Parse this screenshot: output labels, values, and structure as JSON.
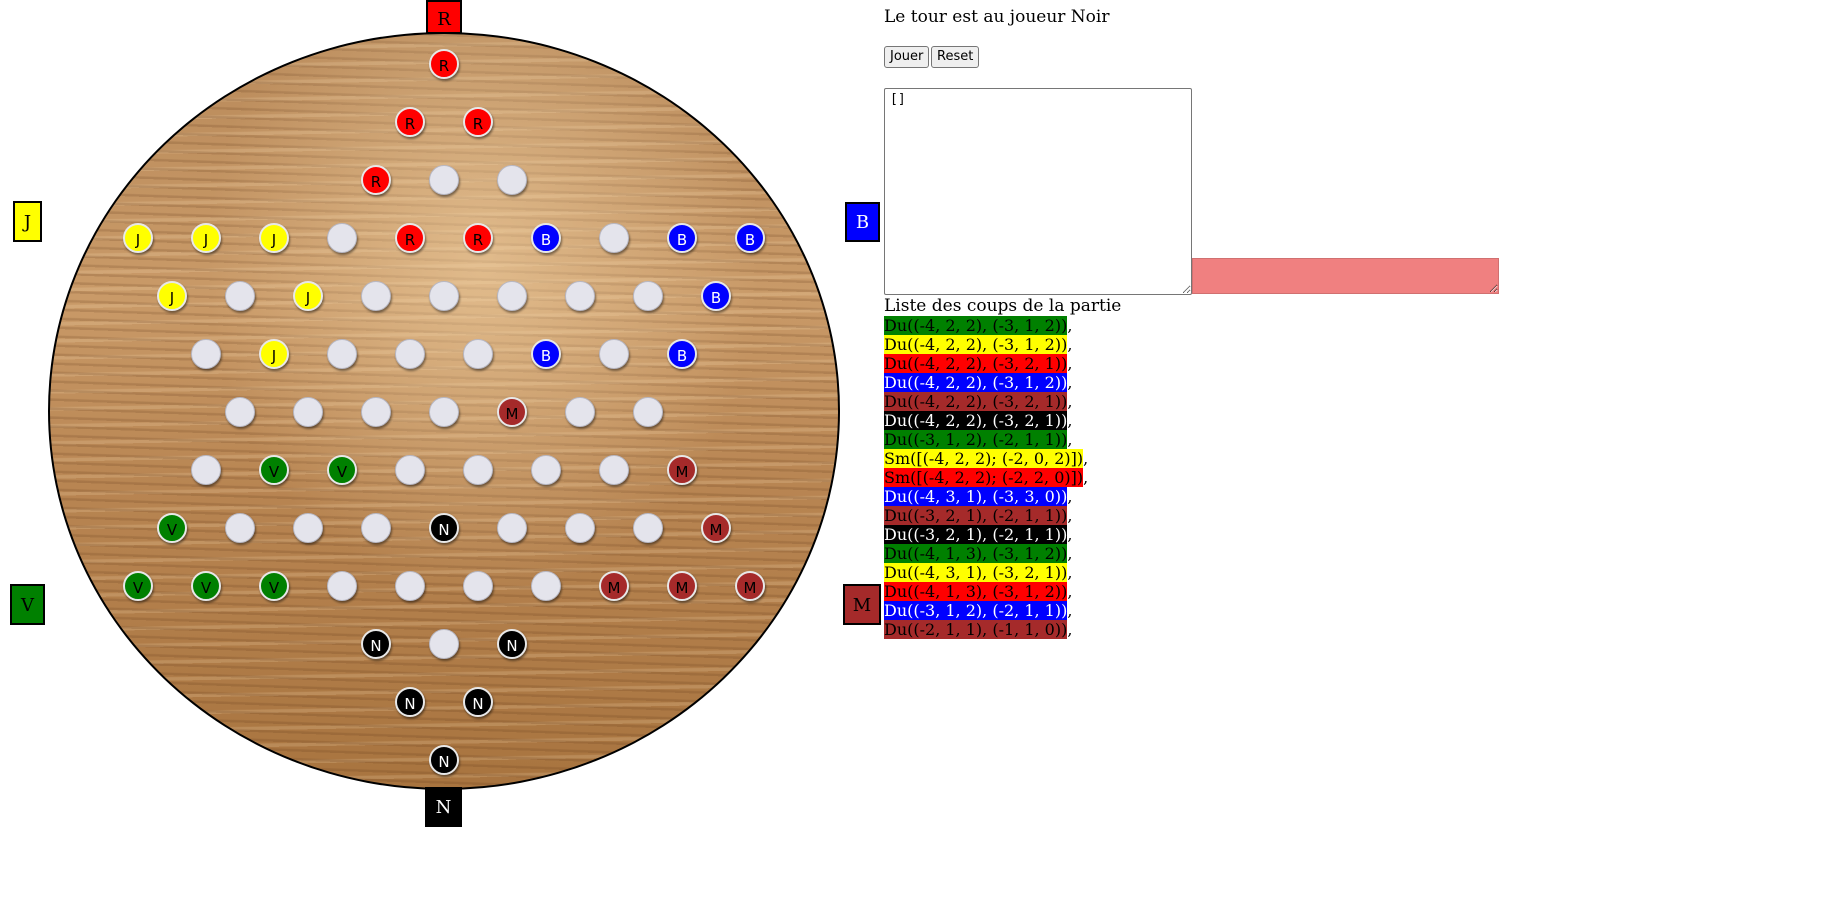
{
  "turn_text": "Le tour est au joueur Noir",
  "buttons": {
    "play": "Jouer",
    "reset": "Reset"
  },
  "moves_textarea_value": "[]",
  "moves_title": "Liste des coups de la partie",
  "player_colors": {
    "R": "#ff0000",
    "J": "#ffff00",
    "B": "#0000ff",
    "M": "#a52a2a",
    "V": "#008000",
    "N": "#000000"
  },
  "corners": {
    "top": "R",
    "left_top": "J",
    "right_top": "B",
    "left_bottom": "V",
    "right_bottom": "M",
    "bottom": "N"
  },
  "board_rows": [
    "R",
    "RR",
    "R..",
    "JJJ.RRB.BB",
    "J.J.....B",
    ".J...B.B",
    "....M..",
    ".VV....M",
    "V...N...M",
    "VVV....MMM",
    "N.N",
    "NN",
    "N"
  ],
  "moves": [
    {
      "text": "Du((-4, 2, 2), (-3, 1, 2))",
      "player": "V"
    },
    {
      "text": "Du((-4, 2, 2), (-3, 1, 2))",
      "player": "J"
    },
    {
      "text": "Du((-4, 2, 2), (-3, 2, 1))",
      "player": "R"
    },
    {
      "text": "Du((-4, 2, 2), (-3, 1, 2))",
      "player": "B"
    },
    {
      "text": "Du((-4, 2, 2), (-3, 2, 1))",
      "player": "M"
    },
    {
      "text": "Du((-4, 2, 2), (-3, 2, 1))",
      "player": "N"
    },
    {
      "text": "Du((-3, 1, 2), (-2, 1, 1))",
      "player": "V"
    },
    {
      "text": "Sm([(-4, 2, 2); (-2, 0, 2)])",
      "player": "J"
    },
    {
      "text": "Sm([(-4, 2, 2); (-2, 2, 0)])",
      "player": "R"
    },
    {
      "text": "Du((-4, 3, 1), (-3, 3, 0))",
      "player": "B"
    },
    {
      "text": "Du((-3, 2, 1), (-2, 1, 1))",
      "player": "M"
    },
    {
      "text": "Du((-3, 2, 1), (-2, 1, 1))",
      "player": "N"
    },
    {
      "text": "Du((-4, 1, 3), (-3, 1, 2))",
      "player": "V"
    },
    {
      "text": "Du((-4, 3, 1), (-3, 2, 1))",
      "player": "J"
    },
    {
      "text": "Du((-4, 1, 3), (-3, 1, 2))",
      "player": "R"
    },
    {
      "text": "Du((-3, 1, 2), (-2, 1, 1))",
      "player": "B"
    },
    {
      "text": "Du((-2, 1, 1), (-1, 1, 0))",
      "player": "M"
    }
  ]
}
